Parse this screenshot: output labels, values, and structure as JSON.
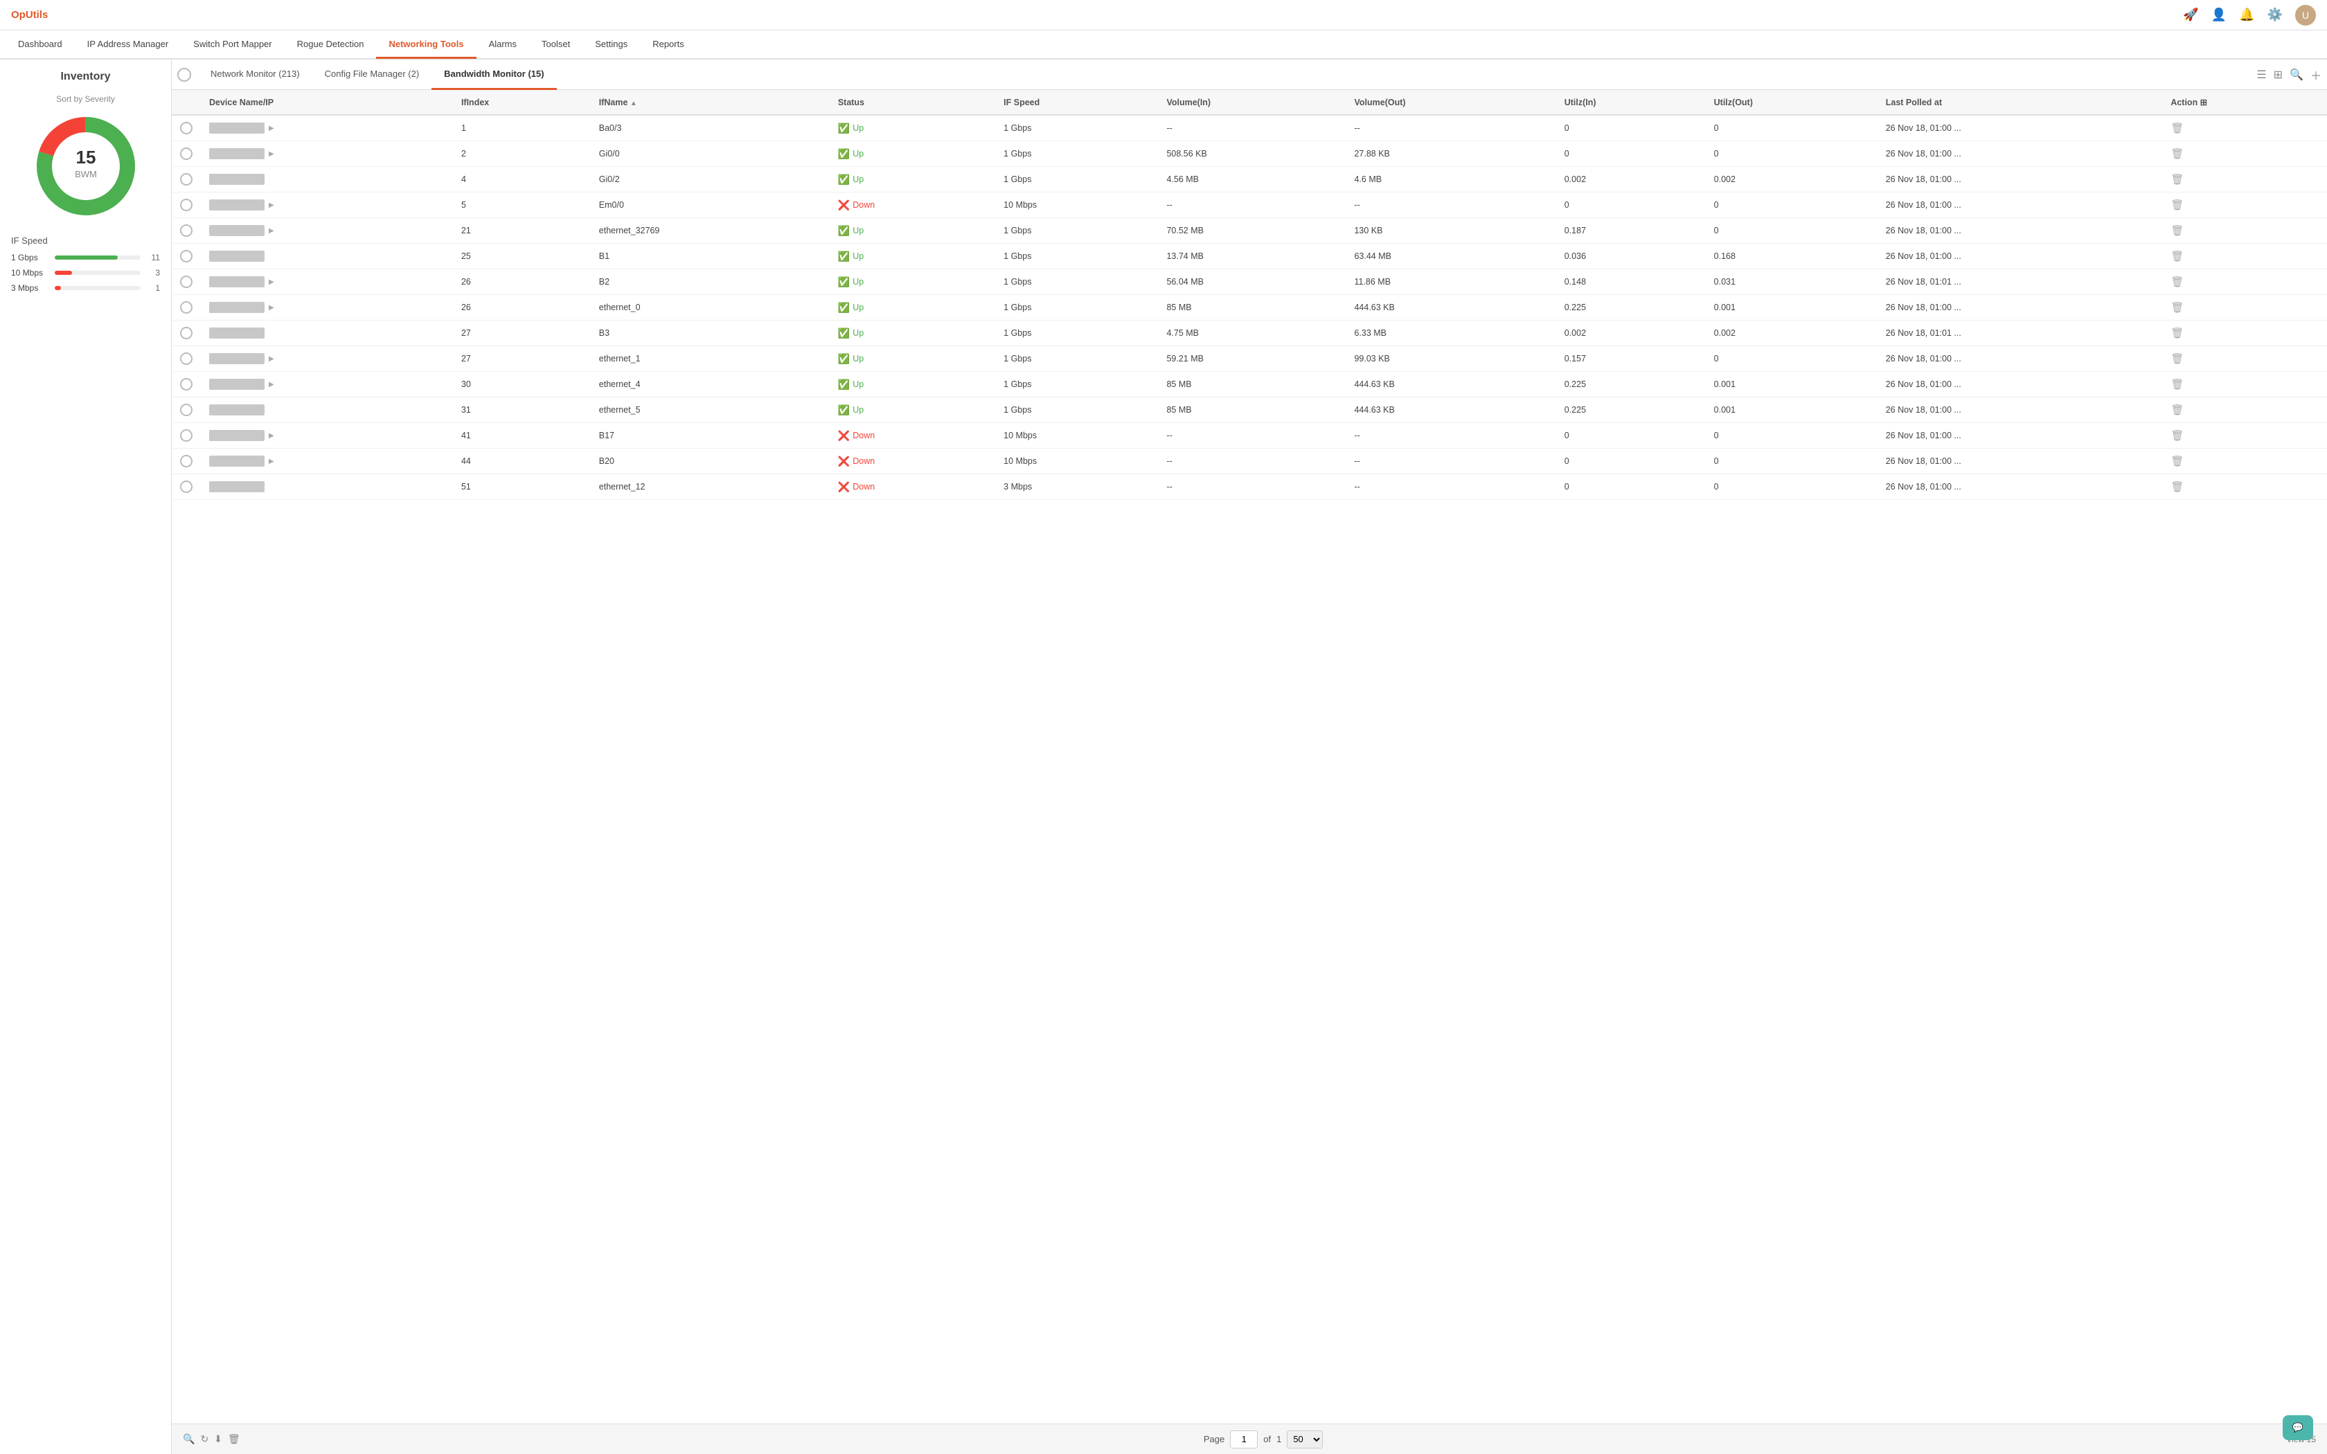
{
  "app": {
    "logo": "OpUtils",
    "topbar_icons": [
      "rocket-icon",
      "user-icon",
      "bell-icon",
      "settings-icon",
      "avatar-icon"
    ],
    "avatar_text": "U"
  },
  "navbar": {
    "items": [
      {
        "label": "Dashboard",
        "active": false
      },
      {
        "label": "IP Address Manager",
        "active": false
      },
      {
        "label": "Switch Port Mapper",
        "active": false
      },
      {
        "label": "Rogue Detection",
        "active": false
      },
      {
        "label": "Networking Tools",
        "active": true
      },
      {
        "label": "Alarms",
        "active": false
      },
      {
        "label": "Toolset",
        "active": false
      },
      {
        "label": "Settings",
        "active": false
      },
      {
        "label": "Reports",
        "active": false
      }
    ]
  },
  "sidebar": {
    "title": "Inventory",
    "sort_by": "Sort by Severity",
    "donut": {
      "total": 15,
      "label": "BWM",
      "segments": [
        {
          "value": 12,
          "color": "#4caf50"
        },
        {
          "value": 3,
          "color": "#f44336"
        }
      ]
    },
    "ifspeed_title": "IF Speed",
    "ifspeed_items": [
      {
        "label": "1 Gbps",
        "count": 11,
        "color": "#4caf50",
        "pct": 73
      },
      {
        "label": "10 Mbps",
        "count": 3,
        "color": "#f44336",
        "pct": 20
      },
      {
        "label": "3 Mbps",
        "count": 1,
        "color": "#f44336",
        "pct": 7
      }
    ]
  },
  "tabs": [
    {
      "label": "Network Monitor",
      "count": 213,
      "active": false
    },
    {
      "label": "Config File Manager",
      "count": 2,
      "active": false
    },
    {
      "label": "Bandwidth Monitor",
      "count": 15,
      "active": true
    }
  ],
  "table": {
    "columns": [
      {
        "label": "",
        "key": "radio"
      },
      {
        "label": "Device Name/IP",
        "key": "device"
      },
      {
        "label": "IfIndex",
        "key": "ifindex"
      },
      {
        "label": "IfName",
        "key": "ifname",
        "sortable": true
      },
      {
        "label": "Status",
        "key": "status"
      },
      {
        "label": "IF Speed",
        "key": "ifspeed"
      },
      {
        "label": "Volume(In)",
        "key": "volume_in"
      },
      {
        "label": "Volume(Out)",
        "key": "volume_out"
      },
      {
        "label": "Utilz(In)",
        "key": "utilz_in"
      },
      {
        "label": "Utilz(Out)",
        "key": "utilz_out"
      },
      {
        "label": "Last Polled at",
        "key": "last_polled"
      },
      {
        "label": "Action",
        "key": "action"
      }
    ],
    "rows": [
      {
        "ifindex": "1",
        "ifname": "Ba0/3",
        "status": "Up",
        "ifspeed": "1 Gbps",
        "volume_in": "--",
        "volume_out": "--",
        "utilz_in": "0",
        "utilz_out": "0",
        "last_polled": "26 Nov 18, 01:00 ..."
      },
      {
        "ifindex": "2",
        "ifname": "Gi0/0",
        "status": "Up",
        "ifspeed": "1 Gbps",
        "volume_in": "508.56 KB",
        "volume_out": "27.88 KB",
        "utilz_in": "0",
        "utilz_out": "0",
        "last_polled": "26 Nov 18, 01:00 ..."
      },
      {
        "ifindex": "4",
        "ifname": "Gi0/2",
        "status": "Up",
        "ifspeed": "1 Gbps",
        "volume_in": "4.56 MB",
        "volume_out": "4.6 MB",
        "utilz_in": "0.002",
        "utilz_out": "0.002",
        "last_polled": "26 Nov 18, 01:00 ..."
      },
      {
        "ifindex": "5",
        "ifname": "Em0/0",
        "status": "Down",
        "ifspeed": "10 Mbps",
        "volume_in": "--",
        "volume_out": "--",
        "utilz_in": "0",
        "utilz_out": "0",
        "last_polled": "26 Nov 18, 01:00 ..."
      },
      {
        "ifindex": "21",
        "ifname": "ethernet_32769",
        "status": "Up",
        "ifspeed": "1 Gbps",
        "volume_in": "70.52 MB",
        "volume_out": "130 KB",
        "utilz_in": "0.187",
        "utilz_out": "0",
        "last_polled": "26 Nov 18, 01:00 ..."
      },
      {
        "ifindex": "25",
        "ifname": "B1",
        "status": "Up",
        "ifspeed": "1 Gbps",
        "volume_in": "13.74 MB",
        "volume_out": "63.44 MB",
        "utilz_in": "0.036",
        "utilz_out": "0.168",
        "last_polled": "26 Nov 18, 01:00 ..."
      },
      {
        "ifindex": "26",
        "ifname": "B2",
        "status": "Up",
        "ifspeed": "1 Gbps",
        "volume_in": "56.04 MB",
        "volume_out": "11.86 MB",
        "utilz_in": "0.148",
        "utilz_out": "0.031",
        "last_polled": "26 Nov 18, 01:01 ..."
      },
      {
        "ifindex": "26",
        "ifname": "ethernet_0",
        "status": "Up",
        "ifspeed": "1 Gbps",
        "volume_in": "85 MB",
        "volume_out": "444.63 KB",
        "utilz_in": "0.225",
        "utilz_out": "0.001",
        "last_polled": "26 Nov 18, 01:00 ..."
      },
      {
        "ifindex": "27",
        "ifname": "B3",
        "status": "Up",
        "ifspeed": "1 Gbps",
        "volume_in": "4.75 MB",
        "volume_out": "6.33 MB",
        "utilz_in": "0.002",
        "utilz_out": "0.002",
        "last_polled": "26 Nov 18, 01:01 ..."
      },
      {
        "ifindex": "27",
        "ifname": "ethernet_1",
        "status": "Up",
        "ifspeed": "1 Gbps",
        "volume_in": "59.21 MB",
        "volume_out": "99.03 KB",
        "utilz_in": "0.157",
        "utilz_out": "0",
        "last_polled": "26 Nov 18, 01:00 ..."
      },
      {
        "ifindex": "30",
        "ifname": "ethernet_4",
        "status": "Up",
        "ifspeed": "1 Gbps",
        "volume_in": "85 MB",
        "volume_out": "444.63 KB",
        "utilz_in": "0.225",
        "utilz_out": "0.001",
        "last_polled": "26 Nov 18, 01:00 ..."
      },
      {
        "ifindex": "31",
        "ifname": "ethernet_5",
        "status": "Up",
        "ifspeed": "1 Gbps",
        "volume_in": "85 MB",
        "volume_out": "444.63 KB",
        "utilz_in": "0.225",
        "utilz_out": "0.001",
        "last_polled": "26 Nov 18, 01:00 ..."
      },
      {
        "ifindex": "41",
        "ifname": "B17",
        "status": "Down",
        "ifspeed": "10 Mbps",
        "volume_in": "--",
        "volume_out": "--",
        "utilz_in": "0",
        "utilz_out": "0",
        "last_polled": "26 Nov 18, 01:00 ..."
      },
      {
        "ifindex": "44",
        "ifname": "B20",
        "status": "Down",
        "ifspeed": "10 Mbps",
        "volume_in": "--",
        "volume_out": "--",
        "utilz_in": "0",
        "utilz_out": "0",
        "last_polled": "26 Nov 18, 01:00 ..."
      },
      {
        "ifindex": "51",
        "ifname": "ethernet_12",
        "status": "Down",
        "ifspeed": "3 Mbps",
        "volume_in": "--",
        "volume_out": "--",
        "utilz_in": "0",
        "utilz_out": "0",
        "last_polled": "26 Nov 18, 01:00 ..."
      }
    ]
  },
  "pagination": {
    "page_label": "Page",
    "current_page": "1",
    "of_label": "of",
    "total_pages": "1",
    "per_page": "50",
    "view_label": "View"
  },
  "chat_button": "💬"
}
